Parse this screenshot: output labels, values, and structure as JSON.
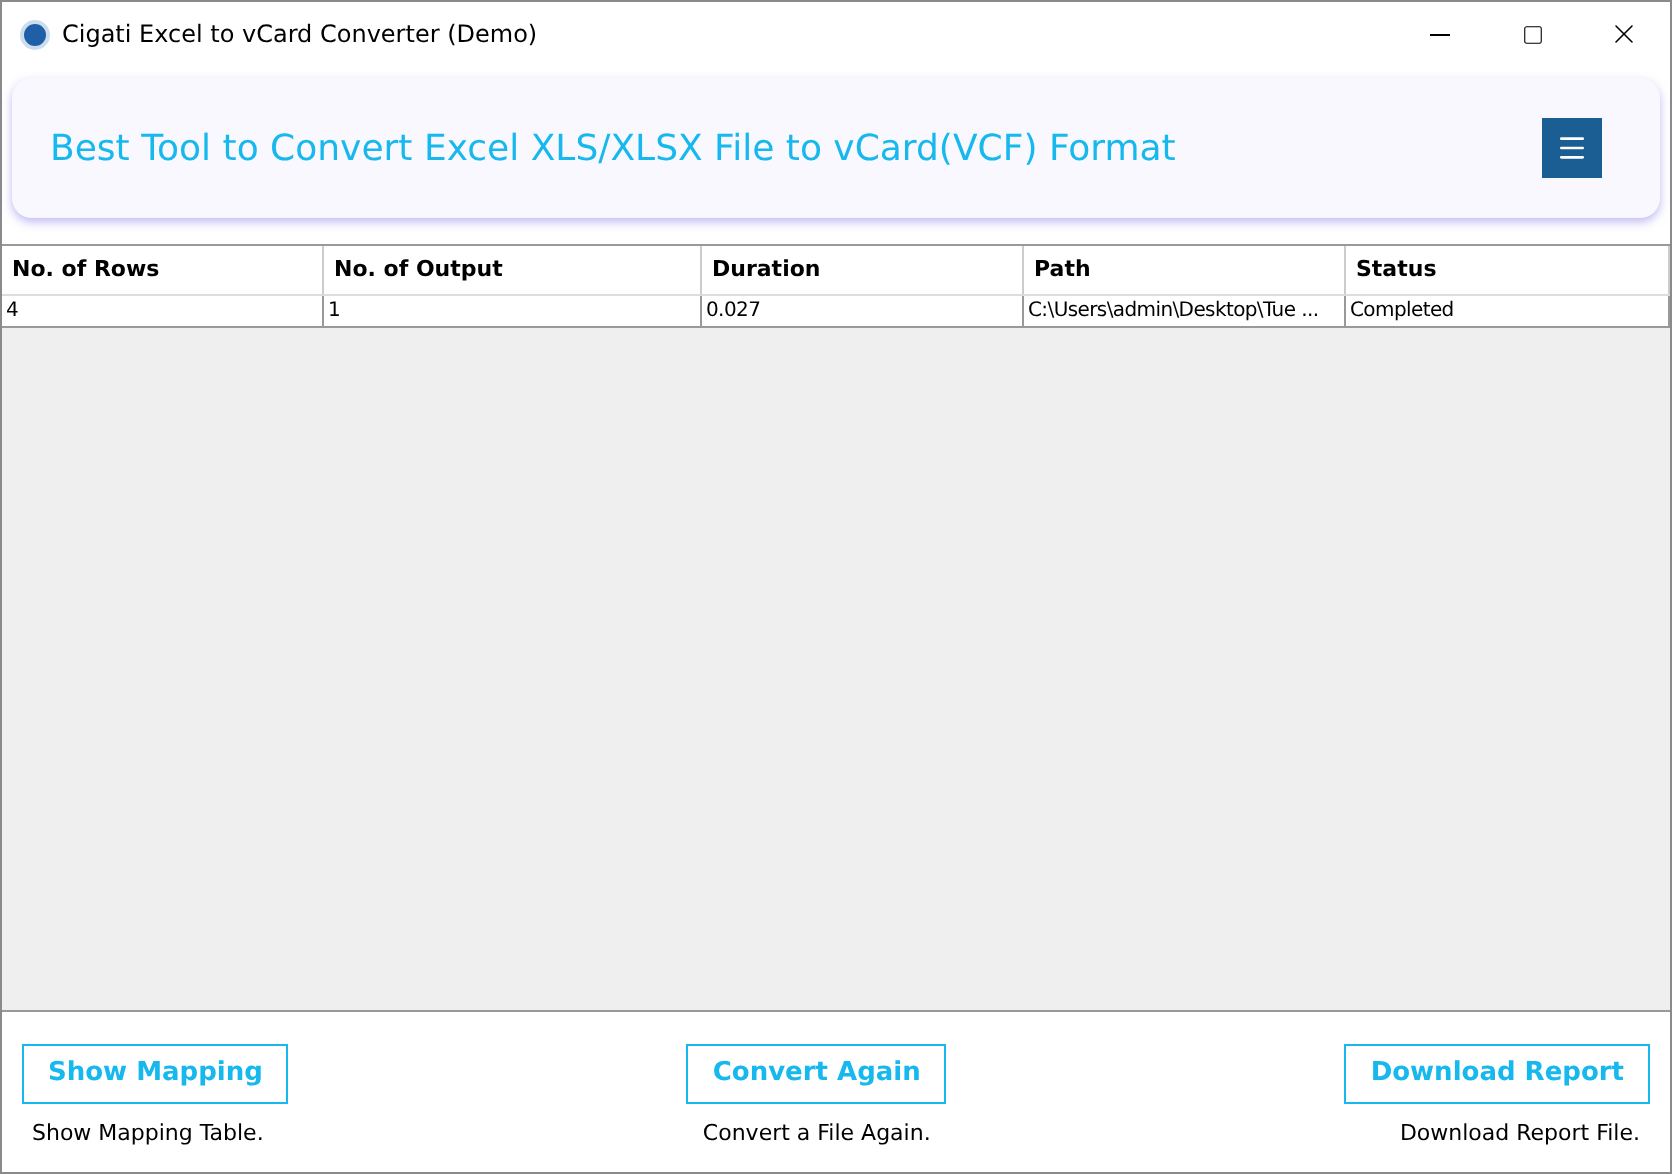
{
  "window": {
    "title": "Cigati Excel to vCard Converter (Demo)"
  },
  "header": {
    "title": "Best Tool to Convert Excel XLS/XLSX File to vCard(VCF) Format"
  },
  "table": {
    "columns": [
      "No. of Rows",
      "No. of Output",
      "Duration",
      "Path",
      "Status"
    ],
    "rows": [
      [
        "4",
        "1",
        "0.027",
        "C:\\Users\\admin\\Desktop\\Tue ...",
        "Completed"
      ]
    ]
  },
  "actions": [
    {
      "label": "Show Mapping",
      "caption": "Show Mapping Table."
    },
    {
      "label": "Convert Again",
      "caption": "Convert a File Again."
    },
    {
      "label": "Download Report",
      "caption": "Download Report File."
    }
  ]
}
